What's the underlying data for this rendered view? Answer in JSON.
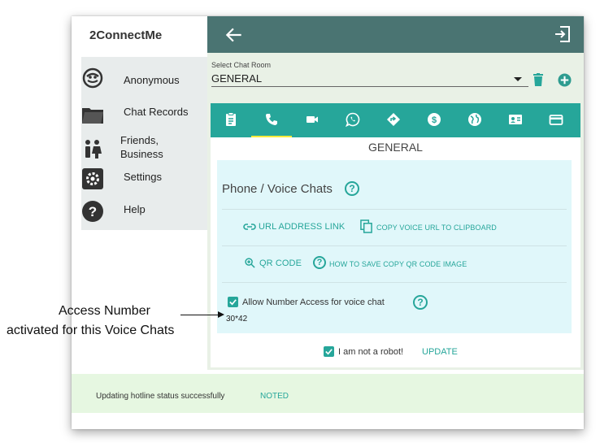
{
  "app": {
    "title": "2ConnectMe"
  },
  "sidebar": {
    "items": [
      {
        "label": "Anonymous",
        "icon": "anonymous-face-icon"
      },
      {
        "label": "Chat Records",
        "icon": "folder-icon"
      },
      {
        "label": "Friends,\nBusiness",
        "icon": "people-icon"
      },
      {
        "label": "Settings",
        "icon": "gear-icon"
      },
      {
        "label": "Help",
        "icon": "help-icon"
      }
    ]
  },
  "header": {
    "back_icon": "arrow-left-icon",
    "exit_icon": "exit-icon"
  },
  "room": {
    "label": "Select Chat Room",
    "value": "GENERAL"
  },
  "tabs": {
    "icons": [
      "clipboard-icon",
      "phone-icon",
      "video-icon",
      "whatsapp-icon",
      "direction-icon",
      "dollar-icon",
      "globe-icon",
      "contact-card-icon",
      "card-icon"
    ],
    "active_index": 1
  },
  "card": {
    "title": "GENERAL",
    "panel_title": "Phone / Voice Chats",
    "url_link": "URL ADDRESS LINK",
    "copy_url": "COPY VOICE URL TO CLIPBOARD",
    "qr_code": "QR CODE",
    "how_to_qr": "HOW TO SAVE COPY QR CODE IMAGE",
    "allow_label": "Allow Number Access for voice chat",
    "allow_checked": true,
    "access_number": "30*42",
    "robot_label": "I am not a robot!",
    "robot_checked": true,
    "update_label": "UPDATE"
  },
  "snackbar": {
    "message": "Updating hotline status successfully",
    "action": "NOTED"
  },
  "annotation": {
    "line1": "Access Number",
    "line2": "activated for this Voice Chats"
  },
  "colors": {
    "header": "#4a7472",
    "accent": "#26a69a",
    "tab_indicator": "#ffeb3b",
    "content_bg": "#e9f1e6",
    "panel_bg": "#e0f7fa",
    "snackbar_bg": "#e6f7e1",
    "add_button": "#2e9c90"
  }
}
